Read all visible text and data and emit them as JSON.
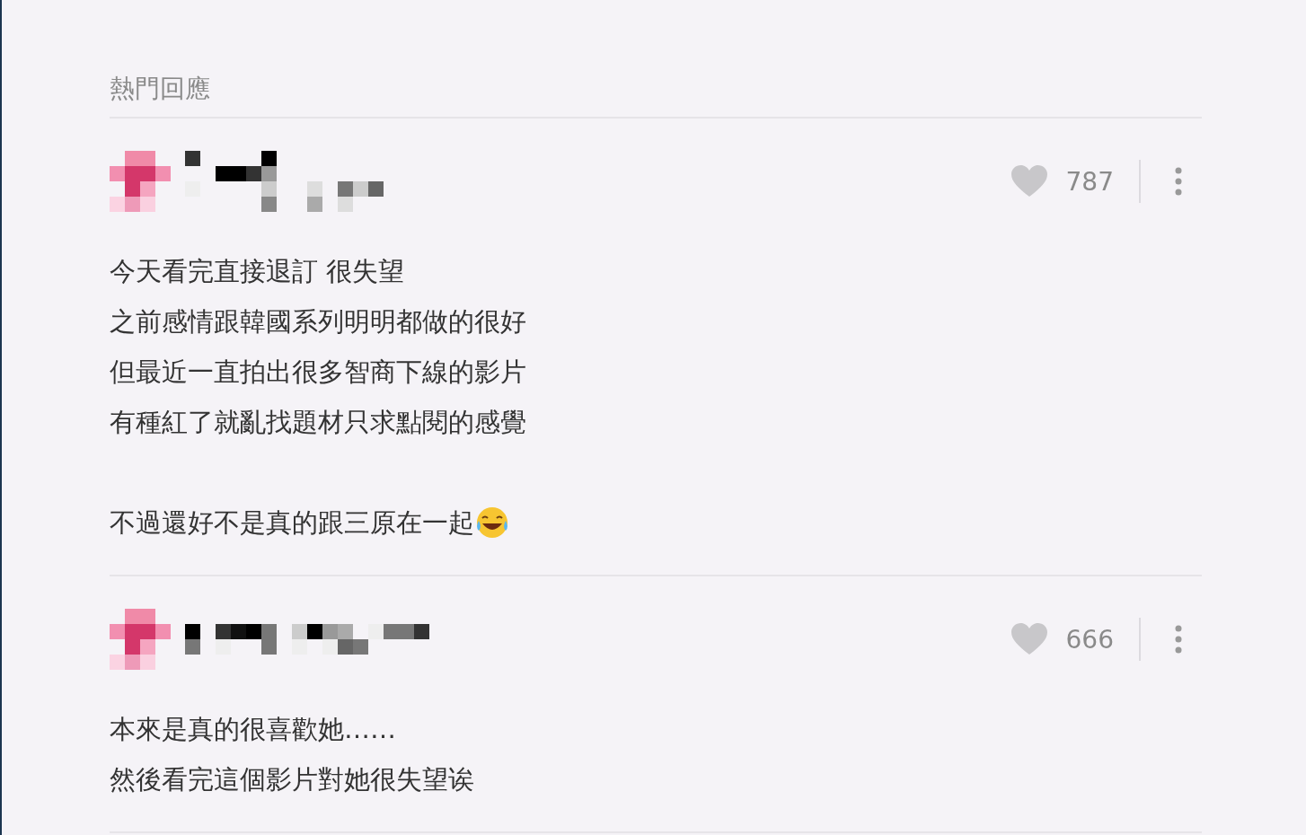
{
  "section_title": "熱門回應",
  "comments": [
    {
      "likes": "787",
      "liked": false,
      "paragraphs": [
        [
          {
            "kind": "text",
            "text": "今天看完直接退訂 很失望"
          },
          {
            "kind": "text",
            "text": "之前感情跟韓國系列明明都做的很好"
          },
          {
            "kind": "text",
            "text": "但最近一直拍出很多智商下線的影片"
          },
          {
            "kind": "text",
            "text": "有種紅了就亂找題材只求點閱的感覺"
          }
        ],
        [
          {
            "kind": "emoji",
            "text": "不過還好不是真的跟三原在一起"
          }
        ]
      ]
    },
    {
      "likes": "666",
      "liked": false,
      "paragraphs": [
        [
          {
            "kind": "text",
            "text": "本來是真的很喜歡她……"
          },
          {
            "kind": "text",
            "text": "然後看完這個影片對她很失望诶"
          }
        ]
      ]
    }
  ]
}
